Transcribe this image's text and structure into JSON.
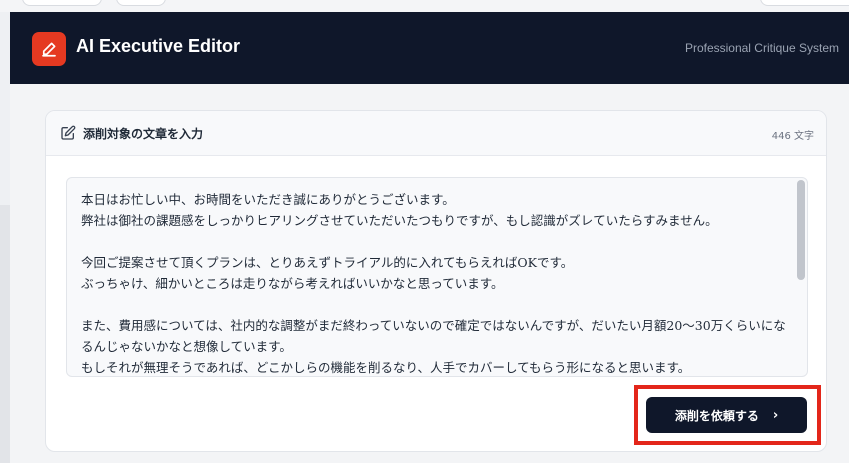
{
  "app": {
    "title": "AI Executive Editor",
    "subtitle": "Professional Critique System",
    "brand_color": "#e53921",
    "header_color": "#0f172a"
  },
  "input_card": {
    "title": "添削対象の文章を入力",
    "char_count": "446 文字",
    "icon": "edit-icon",
    "text": "本日はお忙しい中、お時間をいただき誠にありがとうございます。\n弊社は御社の課題感をしっかりヒアリングさせていただいたつもりですが、もし認識がズレていたらすみません。\n\n今回ご提案させて頂くプランは、とりあえずトライアル的に入れてもらえればOKです。\nぶっちゃけ、細かいところは走りながら考えればいいかなと思っています。\n\nまた、費用感については、社内的な調整がまだ終わっていないので確定ではないんですが、だいたい月額20〜30万くらいになるんじゃないかなと想像しています。\nもしそれが無理そうであれば、どこかしらの機能を削るなり、人手でカバーしてもらう形になると思います。"
  },
  "actions": {
    "submit_label": "添削を依頼する",
    "submit_icon": "chevron-right-icon",
    "highlight_color": "#e3261a"
  }
}
